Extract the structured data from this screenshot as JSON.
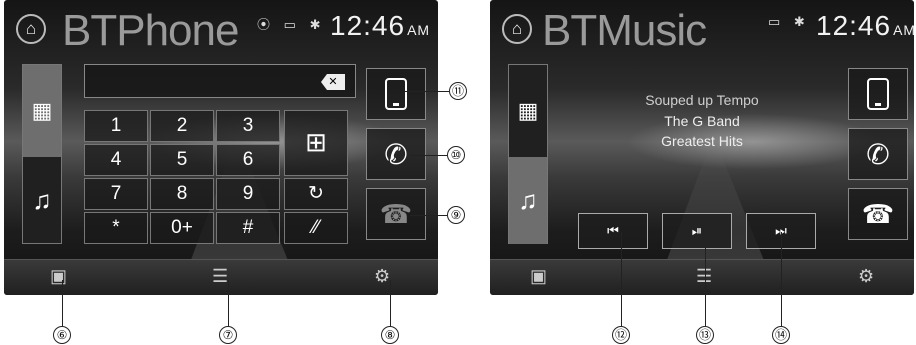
{
  "phone_screen": {
    "title": "BTPhone",
    "time": "12:46",
    "ampm": "AM",
    "status_icons": [
      "record-icon",
      "battery-icon",
      "bluetooth-icon"
    ],
    "keypad": [
      "1",
      "2",
      "3",
      "4",
      "5",
      "6",
      "7",
      "8",
      "9",
      "*",
      "0+",
      "#"
    ],
    "side_keys": [
      "grid-icon",
      "refresh-icon",
      "mute-icon"
    ],
    "right_buttons": [
      "phone-device-icon",
      "call-icon",
      "hangup-icon"
    ]
  },
  "music_screen": {
    "title": "BTMusic",
    "time": "12:46",
    "ampm": "AM",
    "track": {
      "song": "Souped up Tempo",
      "artist": "The G Band",
      "album": "Greatest Hits"
    },
    "controls": [
      "previous",
      "play-pause",
      "next"
    ]
  },
  "callouts": [
    "⑥",
    "⑦",
    "⑧",
    "⑨",
    "⑩",
    "⑪",
    "⑫",
    "⑬",
    "⑭"
  ]
}
